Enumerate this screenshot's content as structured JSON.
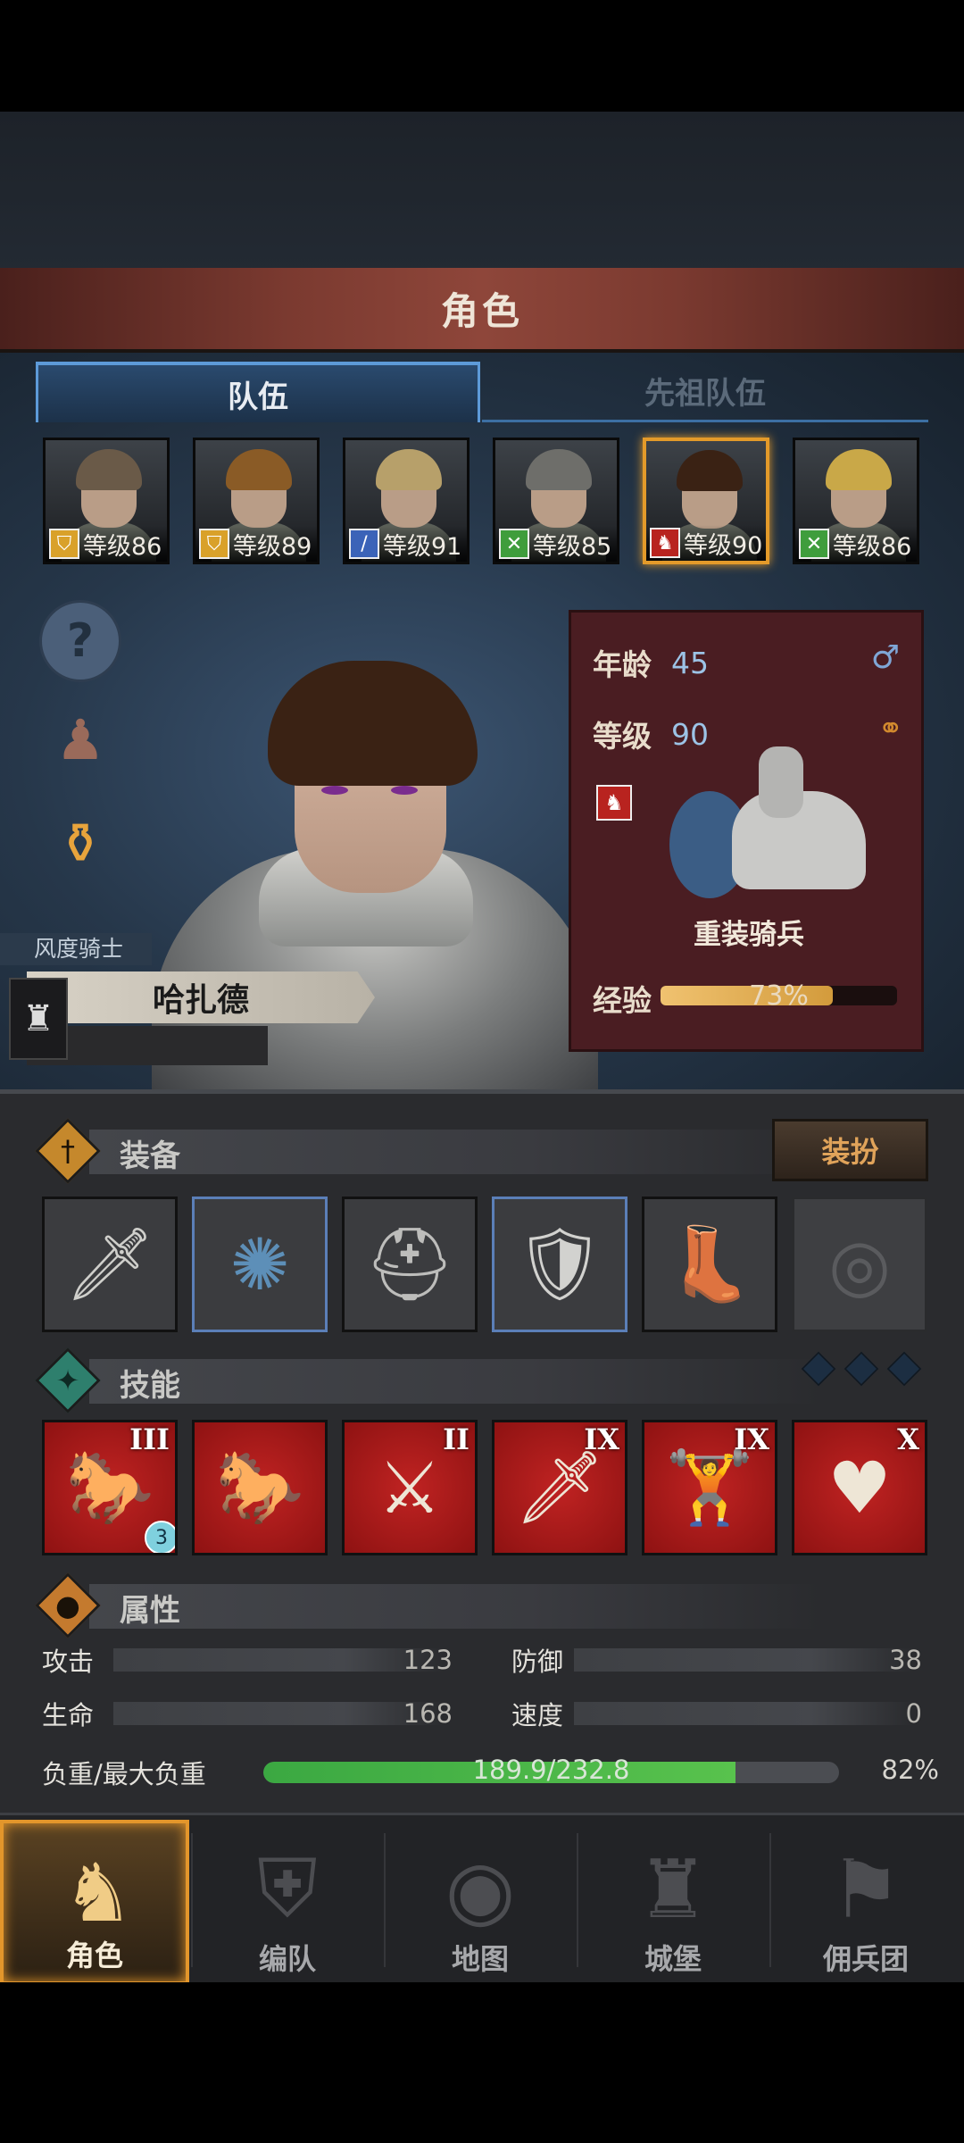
{
  "header": {
    "title": "角色"
  },
  "tabs": [
    {
      "label": "队伍",
      "active": true
    },
    {
      "label": "先祖队伍",
      "active": false
    }
  ],
  "team": [
    {
      "level": "等级86",
      "class_icon": "shield-icon",
      "badge_color": "#d9a12a",
      "hair": "#6a5a48"
    },
    {
      "level": "等级89",
      "class_icon": "shield-icon",
      "badge_color": "#d9a12a",
      "hair": "#8a5b26"
    },
    {
      "level": "等级91",
      "class_icon": "sword-icon",
      "badge_color": "#3b63b8",
      "hair": "#b7a06a"
    },
    {
      "level": "等级85",
      "class_icon": "cross-swords-icon",
      "badge_color": "#3f9d3c",
      "hair": "#6e6e6a"
    },
    {
      "level": "等级90",
      "class_icon": "horse-icon",
      "badge_color": "#b8231f",
      "hair": "#3a2214",
      "selected": true
    },
    {
      "level": "等级86",
      "class_icon": "cross-swords-icon",
      "badge_color": "#3f9d3c",
      "hair": "#c9a848"
    }
  ],
  "hero": {
    "title": "风度骑士",
    "name": "哈扎德",
    "age_label": "年龄",
    "age": "45",
    "level_label": "等级",
    "level": "90",
    "class_name": "重装骑兵",
    "exp_label": "经验",
    "exp_percent": "73%",
    "exp_value": 0.73
  },
  "equipment": {
    "title": "装备",
    "dress_button": "装扮",
    "slots": [
      {
        "name": "spear-item",
        "glyph": "🗡"
      },
      {
        "name": "plume-item",
        "glyph": "✺"
      },
      {
        "name": "helmet-item",
        "glyph": "⛑"
      },
      {
        "name": "armor-item",
        "glyph": "🛡"
      },
      {
        "name": "boots-item",
        "glyph": "👢"
      },
      {
        "name": "ring-slot-empty",
        "glyph": "◎"
      }
    ]
  },
  "skills": {
    "title": "技能",
    "items": [
      {
        "rank": "III",
        "glyph": "🐎",
        "stack": "3"
      },
      {
        "rank": "",
        "glyph": "🐎"
      },
      {
        "rank": "II",
        "glyph": "⚔"
      },
      {
        "rank": "IX",
        "glyph": "🗡"
      },
      {
        "rank": "IX",
        "glyph": "🏋"
      },
      {
        "rank": "X",
        "glyph": "♥"
      }
    ]
  },
  "attributes": {
    "title": "属性",
    "attack_label": "攻击",
    "attack": "123",
    "defense_label": "防御",
    "defense": "38",
    "hp_label": "生命",
    "hp": "168",
    "speed_label": "速度",
    "speed": "0",
    "load_label": "负重/最大负重",
    "load": "189.9/232.8",
    "load_percent": "82%",
    "load_value": 0.82
  },
  "nav": [
    {
      "label": "角色",
      "glyph": "♞",
      "active": true
    },
    {
      "label": "编队",
      "glyph": "⛨"
    },
    {
      "label": "地图",
      "glyph": "◉"
    },
    {
      "label": "城堡",
      "glyph": "♜"
    },
    {
      "label": "佣兵团",
      "glyph": "⚑"
    }
  ],
  "colors": {
    "accent": "#e39a2a",
    "title_bar": "#7b3a30",
    "skill_red": "#c02322",
    "tab_blue": "#5d9ad8"
  }
}
